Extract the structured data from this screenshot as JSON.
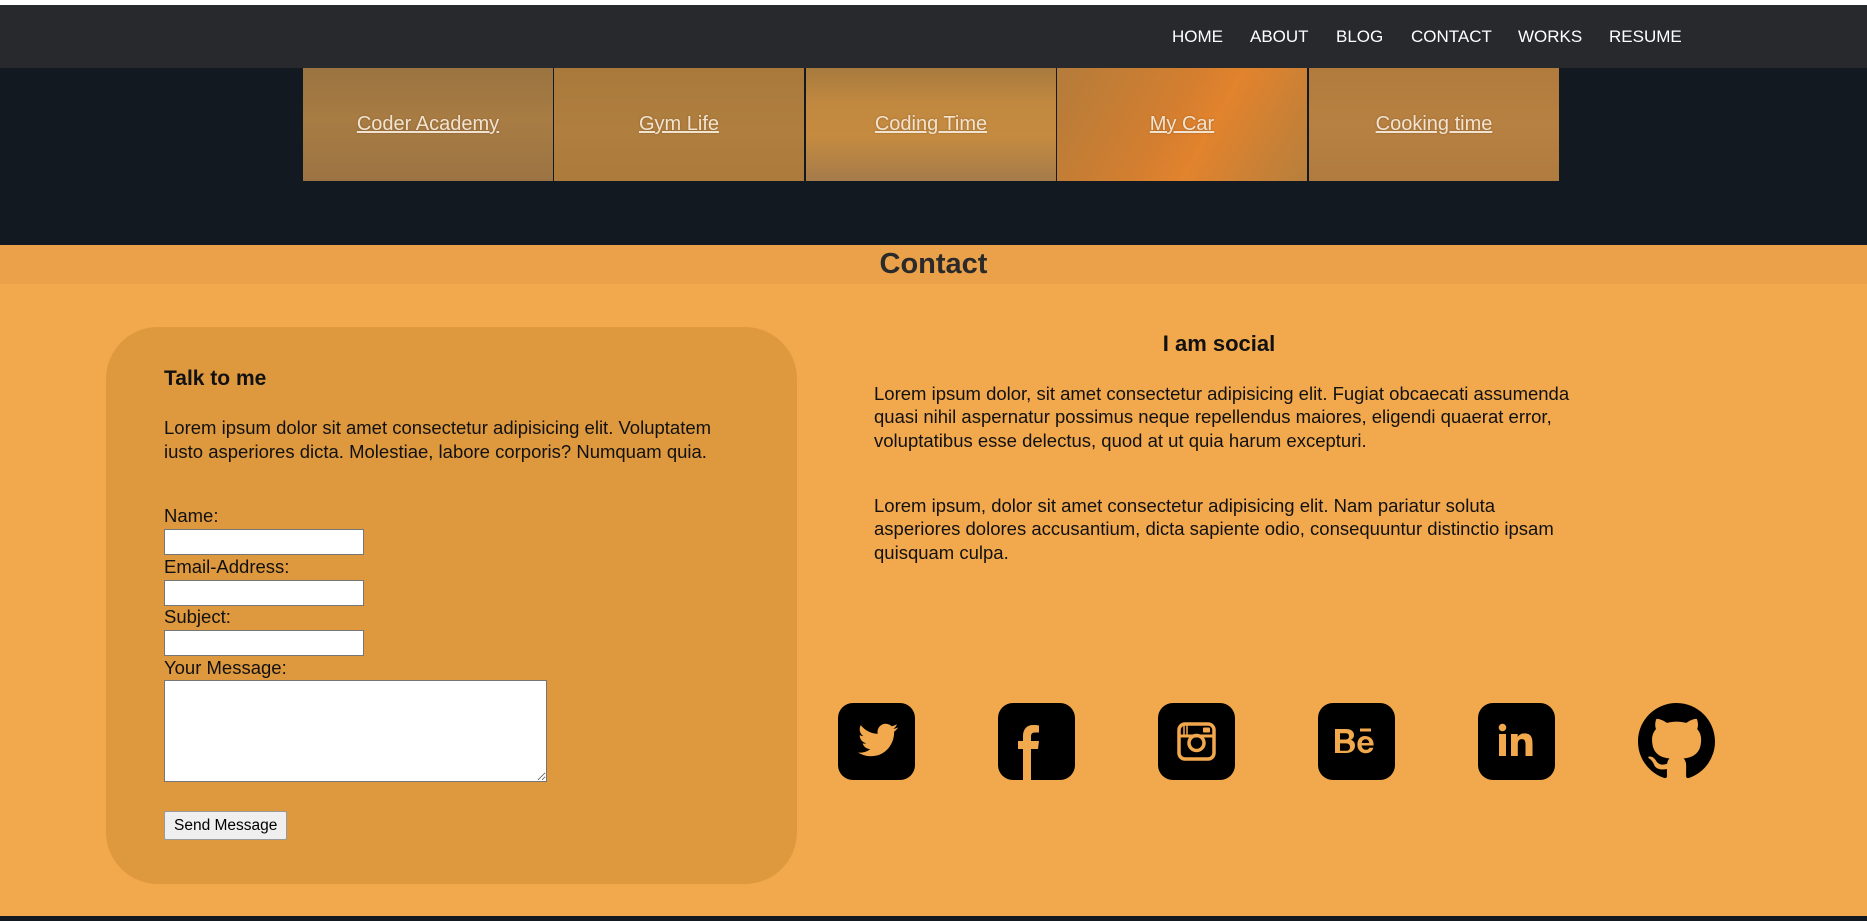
{
  "nav": {
    "items": [
      {
        "label": "HOME"
      },
      {
        "label": "ABOUT"
      },
      {
        "label": "BLOG"
      },
      {
        "label": "CONTACT"
      },
      {
        "label": "WORKS"
      },
      {
        "label": "RESUME"
      }
    ]
  },
  "gallery": {
    "tiles": [
      {
        "label": "Coder Academy"
      },
      {
        "label": "Gym Life"
      },
      {
        "label": "Coding Time"
      },
      {
        "label": "My Car"
      },
      {
        "label": "Cooking time"
      }
    ]
  },
  "contact": {
    "title": "Contact",
    "form": {
      "heading": "Talk to me",
      "intro": "Lorem ipsum dolor sit amet consectetur adipisicing elit. Voluptatem iusto asperiores dicta. Molestiae, labore corporis? Numquam quia.",
      "name_label": "Name:",
      "name_value": "",
      "email_label": "Email-Address:",
      "email_value": "",
      "subject_label": "Subject:",
      "subject_value": "",
      "message_label": "Your Message:",
      "message_value": "",
      "submit_label": "Send Message"
    },
    "social": {
      "heading": "I am social",
      "paragraph_1": "Lorem ipsum dolor, sit amet consectetur adipisicing elit. Fugiat obcaecati assumenda quasi nihil aspernatur possimus neque repellendus maiores, eligendi quaerat error, voluptatibus esse delectus, quod at ut quia harum excepturi.",
      "paragraph_2": "Lorem ipsum, dolor sit amet consectetur adipisicing elit. Nam pariatur soluta asperiores dolores accusantium, dicta sapiente odio, consequuntur distinctio ipsam quisquam culpa.",
      "icons": [
        "twitter-icon",
        "facebook-icon",
        "instagram-icon",
        "behance-icon",
        "linkedin-icon",
        "github-icon"
      ]
    }
  },
  "colors": {
    "navbar": "#27292d",
    "dark_band": "#121920",
    "page_bg": "#f2a84d",
    "header_band": "#eaa149",
    "form_card": "#de983e",
    "icon": "#000000"
  }
}
